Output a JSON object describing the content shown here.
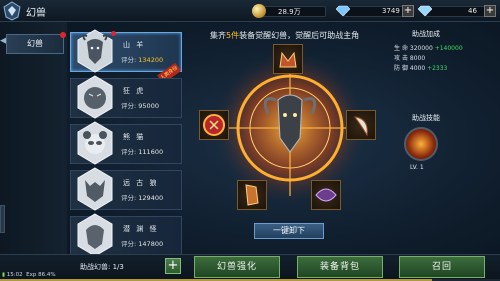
{
  "app": {
    "title": "幻兽"
  },
  "resources": [
    {
      "icon": "gold-coin-icon",
      "value": "28.9万"
    },
    {
      "icon": "diamond-icon",
      "value": "3749",
      "has_plus": true
    },
    {
      "icon": "bound-diamond-icon",
      "value": "46",
      "has_plus": true
    }
  ],
  "nav": {
    "tab_label": "幻兽"
  },
  "pets": [
    {
      "name": "山 羊",
      "score_label": "评分:",
      "score": "134200",
      "selected": true,
      "badge": "人类身份"
    },
    {
      "name": "狂 虎",
      "score_label": "评分:",
      "score": "95000"
    },
    {
      "name": "熊 猫",
      "score_label": "评分:",
      "score": "111600"
    },
    {
      "name": "远 古 狼",
      "score_label": "评分:",
      "score": "129400"
    },
    {
      "name": "潜 渊 怪",
      "score_label": "评分:",
      "score": "147800"
    }
  ],
  "center": {
    "instruction_pre": "集齐",
    "instruction_hl": "5件",
    "instruction_post": "装备觉醒幻兽，觉醒后可助战主角",
    "unload_label": "一键卸下"
  },
  "bonus": {
    "title": "助战加成",
    "stats": [
      {
        "label": "生",
        "sub": "命",
        "value": "320000",
        "inc": "+140000"
      },
      {
        "label": "攻",
        "sub": "击",
        "value": "8000",
        "inc": ""
      },
      {
        "label": "防",
        "sub": "御",
        "value": "4000",
        "inc": "+2333"
      }
    ]
  },
  "skill": {
    "title": "助战技能",
    "level": "LV. 1"
  },
  "bottom": {
    "help_label": "助战幻兽:",
    "help_count": "1/3",
    "btn_enhance": "幻兽强化",
    "btn_bag": "装备背包",
    "btn_summon": "召回"
  },
  "status": {
    "time": "15:02",
    "exp": "Exp 86.4%",
    "exp_fraction": 0.864
  }
}
